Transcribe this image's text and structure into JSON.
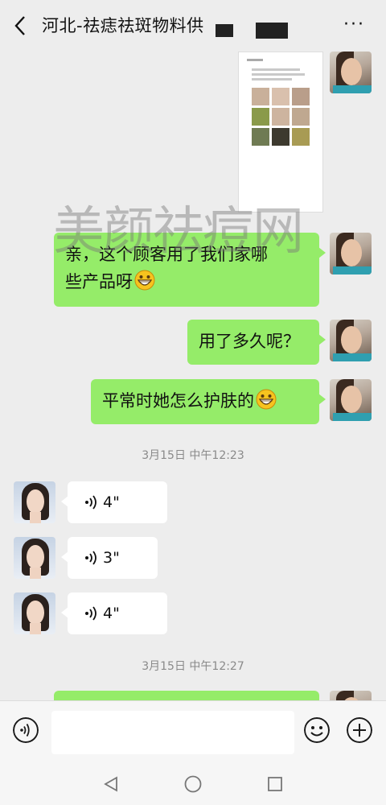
{
  "header": {
    "title": "河北-祛痣祛斑物料供",
    "back_icon": "chevron-left-icon",
    "more_icon": "more-dots-icon",
    "more_label": "···"
  },
  "watermark": "美颜祛痘网",
  "messages": [
    {
      "type": "image",
      "sender": "me"
    },
    {
      "type": "text",
      "sender": "me",
      "lines": [
        "亲，这个顾客用了我们家哪",
        "些产品呀"
      ],
      "emoji": "grinning-face"
    },
    {
      "type": "text",
      "sender": "me",
      "text": "用了多久呢？"
    },
    {
      "type": "text",
      "sender": "me",
      "text": "平常时她怎么护肤的",
      "emoji": "grinning-face"
    }
  ],
  "timestamps": [
    "3月15日 中午12:23",
    "3月15日 中午12:27"
  ],
  "voice_messages": [
    {
      "duration": "4\""
    },
    {
      "duration": "3\""
    },
    {
      "duration": "4\""
    }
  ],
  "colors": {
    "background": "#ededed",
    "my_bubble": "#95ec69",
    "their_bubble": "#ffffff"
  },
  "input_bar": {
    "voice_icon": "voice-mode-icon",
    "emoji_icon": "emoji-icon",
    "plus_icon": "plus-icon"
  },
  "system_nav": {
    "back": "nav-back-icon",
    "home": "nav-home-icon",
    "recents": "nav-recents-icon"
  }
}
